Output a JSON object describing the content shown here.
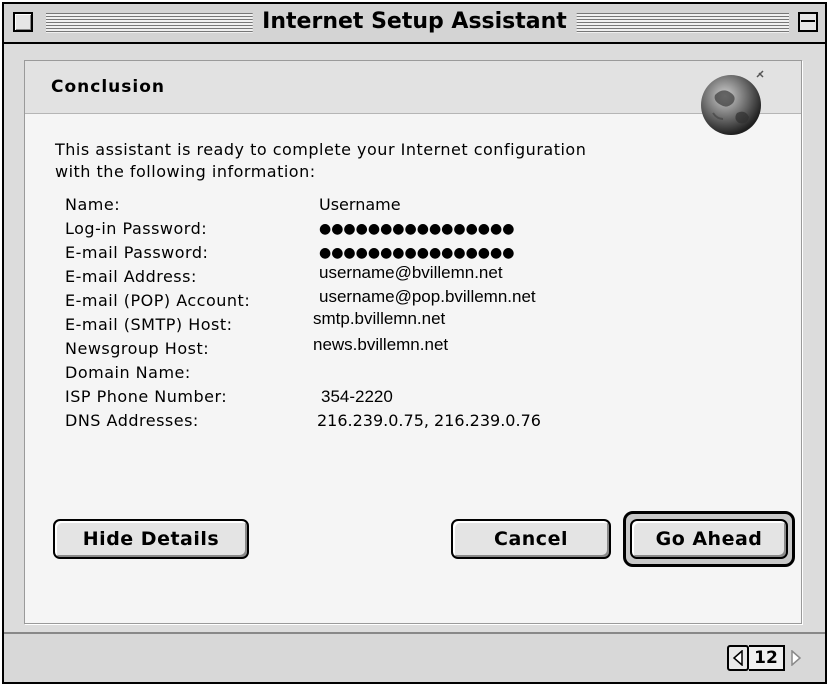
{
  "window": {
    "title": "Internet Setup Assistant"
  },
  "section": {
    "title": "Conclusion"
  },
  "intro_text": "This assistant is ready to complete your Internet configuration with the following information:",
  "details": [
    {
      "label": "Name:",
      "value": "Username"
    },
    {
      "label": "Log-in Password:",
      "value": "●●●●●●●●●●●●●●●●"
    },
    {
      "label": "E-mail Password:",
      "value": "●●●●●●●●●●●●●●●●"
    },
    {
      "label": "E-mail Address:",
      "value": "username@bvillemn.net"
    },
    {
      "label": "E-mail (POP) Account:",
      "value": "username@pop.bvillemn.net"
    },
    {
      "label": "E-mail (SMTP) Host:",
      "value": "smtp.bvillemn.net"
    },
    {
      "label": "Newsgroup Host:",
      "value": "news.bvillemn.net"
    },
    {
      "label": "Domain Name:",
      "value": ""
    },
    {
      "label": "ISP Phone Number:",
      "value": "354-2220"
    },
    {
      "label": "DNS Addresses:",
      "value": "216.239.0.75, 216.239.0.76"
    }
  ],
  "buttons": {
    "hide_details": "Hide Details",
    "cancel": "Cancel",
    "go_ahead": "Go Ahead"
  },
  "navigation": {
    "page": "12",
    "prev_icon": "left-arrow-icon",
    "next_icon": "right-arrow-icon"
  }
}
